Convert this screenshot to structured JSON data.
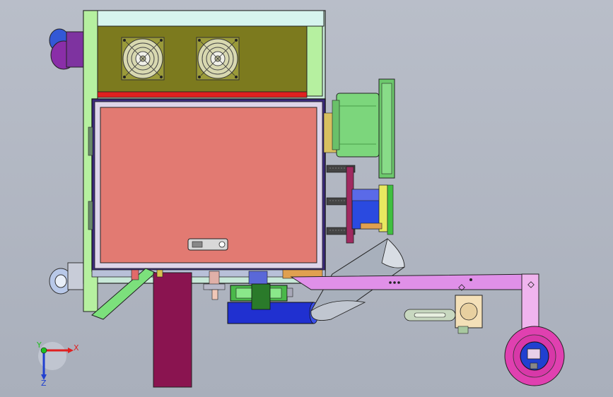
{
  "viewport": {
    "background": "#b0b5c1"
  },
  "triad": {
    "x_label": "X",
    "y_label": "Y",
    "z_label": "Z",
    "x_color": "#e02020",
    "y_color": "#20c020",
    "z_color": "#2040d0"
  },
  "parts": {
    "cabinet_frame": "#b8f0a8",
    "top_panel": "#7a7a20",
    "door_panel": "#e07870",
    "door_frame": "#3a2a7a",
    "motor": "#7cd67c",
    "chute": "#b8bec8",
    "arm": "#e090e8",
    "wheel": "#e040b0",
    "hub": "#2040d0",
    "leg": "#8a1450",
    "pipe": "#2030d0"
  }
}
